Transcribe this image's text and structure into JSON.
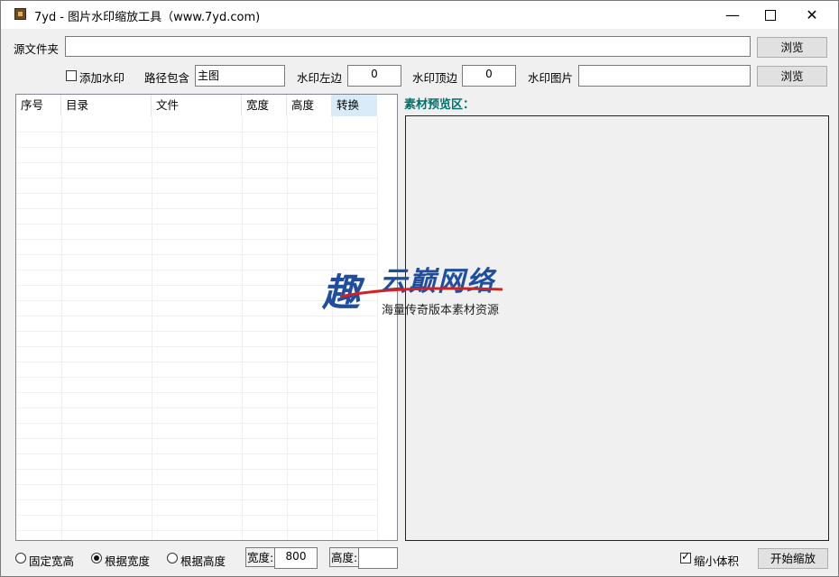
{
  "window": {
    "title": "7yd - 图片水印缩放工具（www.7yd.com)",
    "minimize": "—",
    "close": "✕"
  },
  "source": {
    "label": "源文件夹",
    "value": "",
    "browse": "浏览"
  },
  "watermark": {
    "add_label": "添加水印",
    "add_checked": false,
    "path_label": "路径包含",
    "path_value": "主图",
    "left_label": "水印左边",
    "left_value": "0",
    "top_label": "水印顶边",
    "top_value": "0",
    "image_label": "水印图片",
    "image_value": "",
    "browse": "浏览"
  },
  "table": {
    "columns": [
      "序号",
      "目录",
      "文件",
      "宽度",
      "高度",
      "转换"
    ],
    "rows": []
  },
  "preview": {
    "label": "素材预览区："
  },
  "overlay": {
    "logo_char": "趣",
    "brand": "云巅网络",
    "tagline": "海量传奇版本素材资源"
  },
  "bottom": {
    "radio_fixed": "固定宽高",
    "radio_width": "根据宽度",
    "radio_height": "根据高度",
    "selected": "width",
    "width_label": "宽度:",
    "width_value": "800",
    "height_label": "高度:",
    "height_value": "",
    "shrink_label": "缩小体积",
    "shrink_checked": true,
    "start_button": "开始缩放"
  }
}
